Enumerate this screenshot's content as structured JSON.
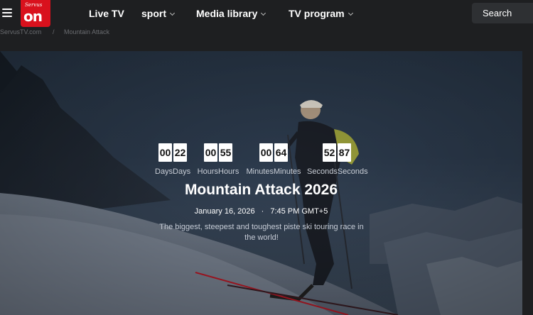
{
  "header": {
    "logo_script": "Servus",
    "logo_text": "on",
    "nav": [
      {
        "label": "Live TV",
        "has_dropdown": false
      },
      {
        "label": "sport",
        "has_dropdown": true
      },
      {
        "label": "Media library",
        "has_dropdown": true
      },
      {
        "label": "TV program",
        "has_dropdown": true
      }
    ],
    "search_label": "Search"
  },
  "breadcrumb": {
    "home": "ServusTV.com",
    "separator": "/",
    "current": "Mountain Attack"
  },
  "hero": {
    "countdown": [
      {
        "digits": [
          "00",
          "22"
        ],
        "label": "DaysDays"
      },
      {
        "digits": [
          "00",
          "55"
        ],
        "label": "HoursHours"
      },
      {
        "digits": [
          "00",
          "64"
        ],
        "label": "MinutesMinutes"
      },
      {
        "digits": [
          "52",
          "87"
        ],
        "label": "SecondsSeconds"
      }
    ],
    "title": "Mountain Attack 2026",
    "date": "January 16, 2026",
    "date_separator": "·",
    "time": "7:45 PM GMT+5",
    "description": "The biggest, steepest and toughest piste ski touring race in the world!"
  },
  "colors": {
    "brand_red": "#d9111d",
    "page_bg": "#1e1f21",
    "search_bg": "#2e3033"
  }
}
